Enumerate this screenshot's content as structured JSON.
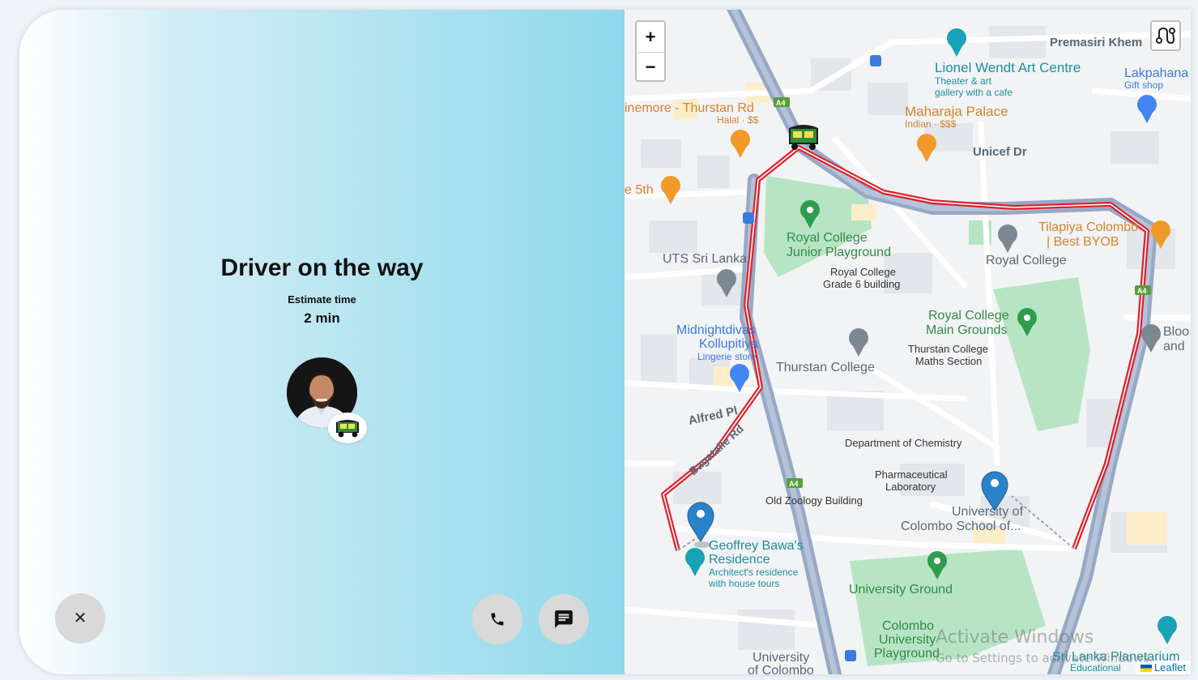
{
  "trip": {
    "title": "Driver on the way",
    "estimate_label": "Estimate time",
    "estimate_value": "2 min"
  },
  "driver": {
    "avatar_icon": "driver-photo",
    "vehicle_icon": "tuk-tuk-icon"
  },
  "actions": {
    "cancel_glyph": "✕",
    "call_icon": "phone-icon",
    "message_icon": "chat-icon"
  },
  "map": {
    "zoom_in": "+",
    "zoom_out": "−",
    "attribution": "Leaflet",
    "labels": {
      "premasiri": "Premasiri Khem",
      "lionel": "Lionel Wendt Art Centre",
      "lionel_sub1": "Theater & art",
      "lionel_sub2": "gallery with a cafe",
      "lakpahana": "Lakpahana",
      "lakpahana_sub": "Gift shop",
      "thurstan_rd_rest": "inemore - Thurstan Rd",
      "thurstan_rd_sub": "Halal · $$",
      "maharaja": "Maharaja Palace",
      "maharaja_sub": "Indian · $$$",
      "unicef": "Unicef Dr",
      "the5th": "e 5th",
      "tilapiya1": "Tilapiya Colombo",
      "tilapiya2": "| Best BYOB",
      "rc_junior1": "Royal College",
      "rc_junior2": "Junior Playground",
      "rc_grade1": "Royal College",
      "rc_grade2": "Grade 6 building",
      "royal_college": "Royal College",
      "uts": "UTS Sri Lanka",
      "rc_main1": "Royal College",
      "rc_main2": "Main Grounds",
      "midnight1": "Midnightdivas",
      "midnight2": "Kollupitiya",
      "midnight_sub": "Lingerie store",
      "thurstan_maths1": "Thurstan College",
      "thurstan_maths2": "Maths Section",
      "thurstan_college": "Thurstan College",
      "blo1": "Bloo",
      "blo2": "and",
      "alfred": "Alfred Pl",
      "bagatalle": "Bagatalle Rd",
      "chemistry": "Department of Chemistry",
      "pharma1": "Pharmaceutical",
      "pharma2": "Laboratory",
      "zoology": "Old Zoology Building",
      "uoc_school1": "University of",
      "uoc_school2": "Colombo School of...",
      "bawa1": "Geoffrey Bawa's",
      "bawa2": "Residence",
      "bawa_sub1": "Architect's residence",
      "bawa_sub2": "with house tours",
      "uni_ground": "University Ground",
      "cup1": "Colombo",
      "cup2": "University",
      "cup3": "Playground",
      "uoc1": "University",
      "uoc2": "of Colombo",
      "planetarium": "Sri Lanka Planetarium",
      "planetarium_sub": "Educational",
      "a4": "A4"
    }
  },
  "watermark": {
    "title": "Activate Windows",
    "subtitle": "Go to Settings to activate Windows."
  },
  "colors": {
    "route": "#e0202a",
    "marker": "#2a82cb",
    "park": "#b7e5c4",
    "road_main": "#96a9c6"
  }
}
